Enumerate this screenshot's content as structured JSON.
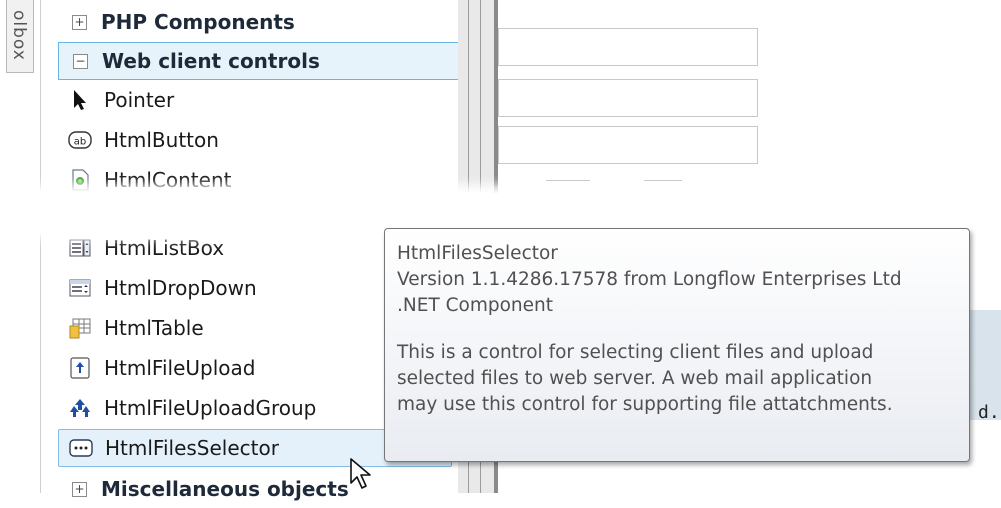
{
  "side_tab": {
    "label": "olbox"
  },
  "toolbox": {
    "categories": {
      "php": {
        "label": "PHP Components",
        "expander": "+"
      },
      "web": {
        "label": "Web client controls",
        "expander": "−"
      },
      "misc": {
        "label": "Miscellaneous objects",
        "expander": "+"
      }
    },
    "items": [
      {
        "label": "Pointer",
        "icon": "pointer-arrow-icon"
      },
      {
        "label": "HtmlButton",
        "icon": "button-ab-icon"
      },
      {
        "label": "HtmlContent",
        "icon": "content-page-icon"
      },
      {
        "label": "HtmlListBox",
        "icon": "listbox-icon"
      },
      {
        "label": "HtmlDropDown",
        "icon": "dropdown-icon"
      },
      {
        "label": "HtmlTable",
        "icon": "table-icon"
      },
      {
        "label": "HtmlFileUpload",
        "icon": "file-upload-icon"
      },
      {
        "label": "HtmlFileUploadGroup",
        "icon": "file-upload-group-icon"
      },
      {
        "label": "HtmlFilesSelector",
        "icon": "files-selector-icon"
      }
    ]
  },
  "designer": {
    "trailing_text": "d."
  },
  "tooltip": {
    "title": "HtmlFilesSelector",
    "version": "Version 1.1.4286.17578 from Longflow Enterprises Ltd",
    "type": ".NET Component",
    "description": [
      "This is a control for selecting client files and upload",
      "selected files to web server. A web mail application",
      "may use this control for supporting file attatchments."
    ]
  },
  "colors": {
    "selection_bg": "#e6f3fb",
    "selection_border": "#6bb3e0"
  }
}
